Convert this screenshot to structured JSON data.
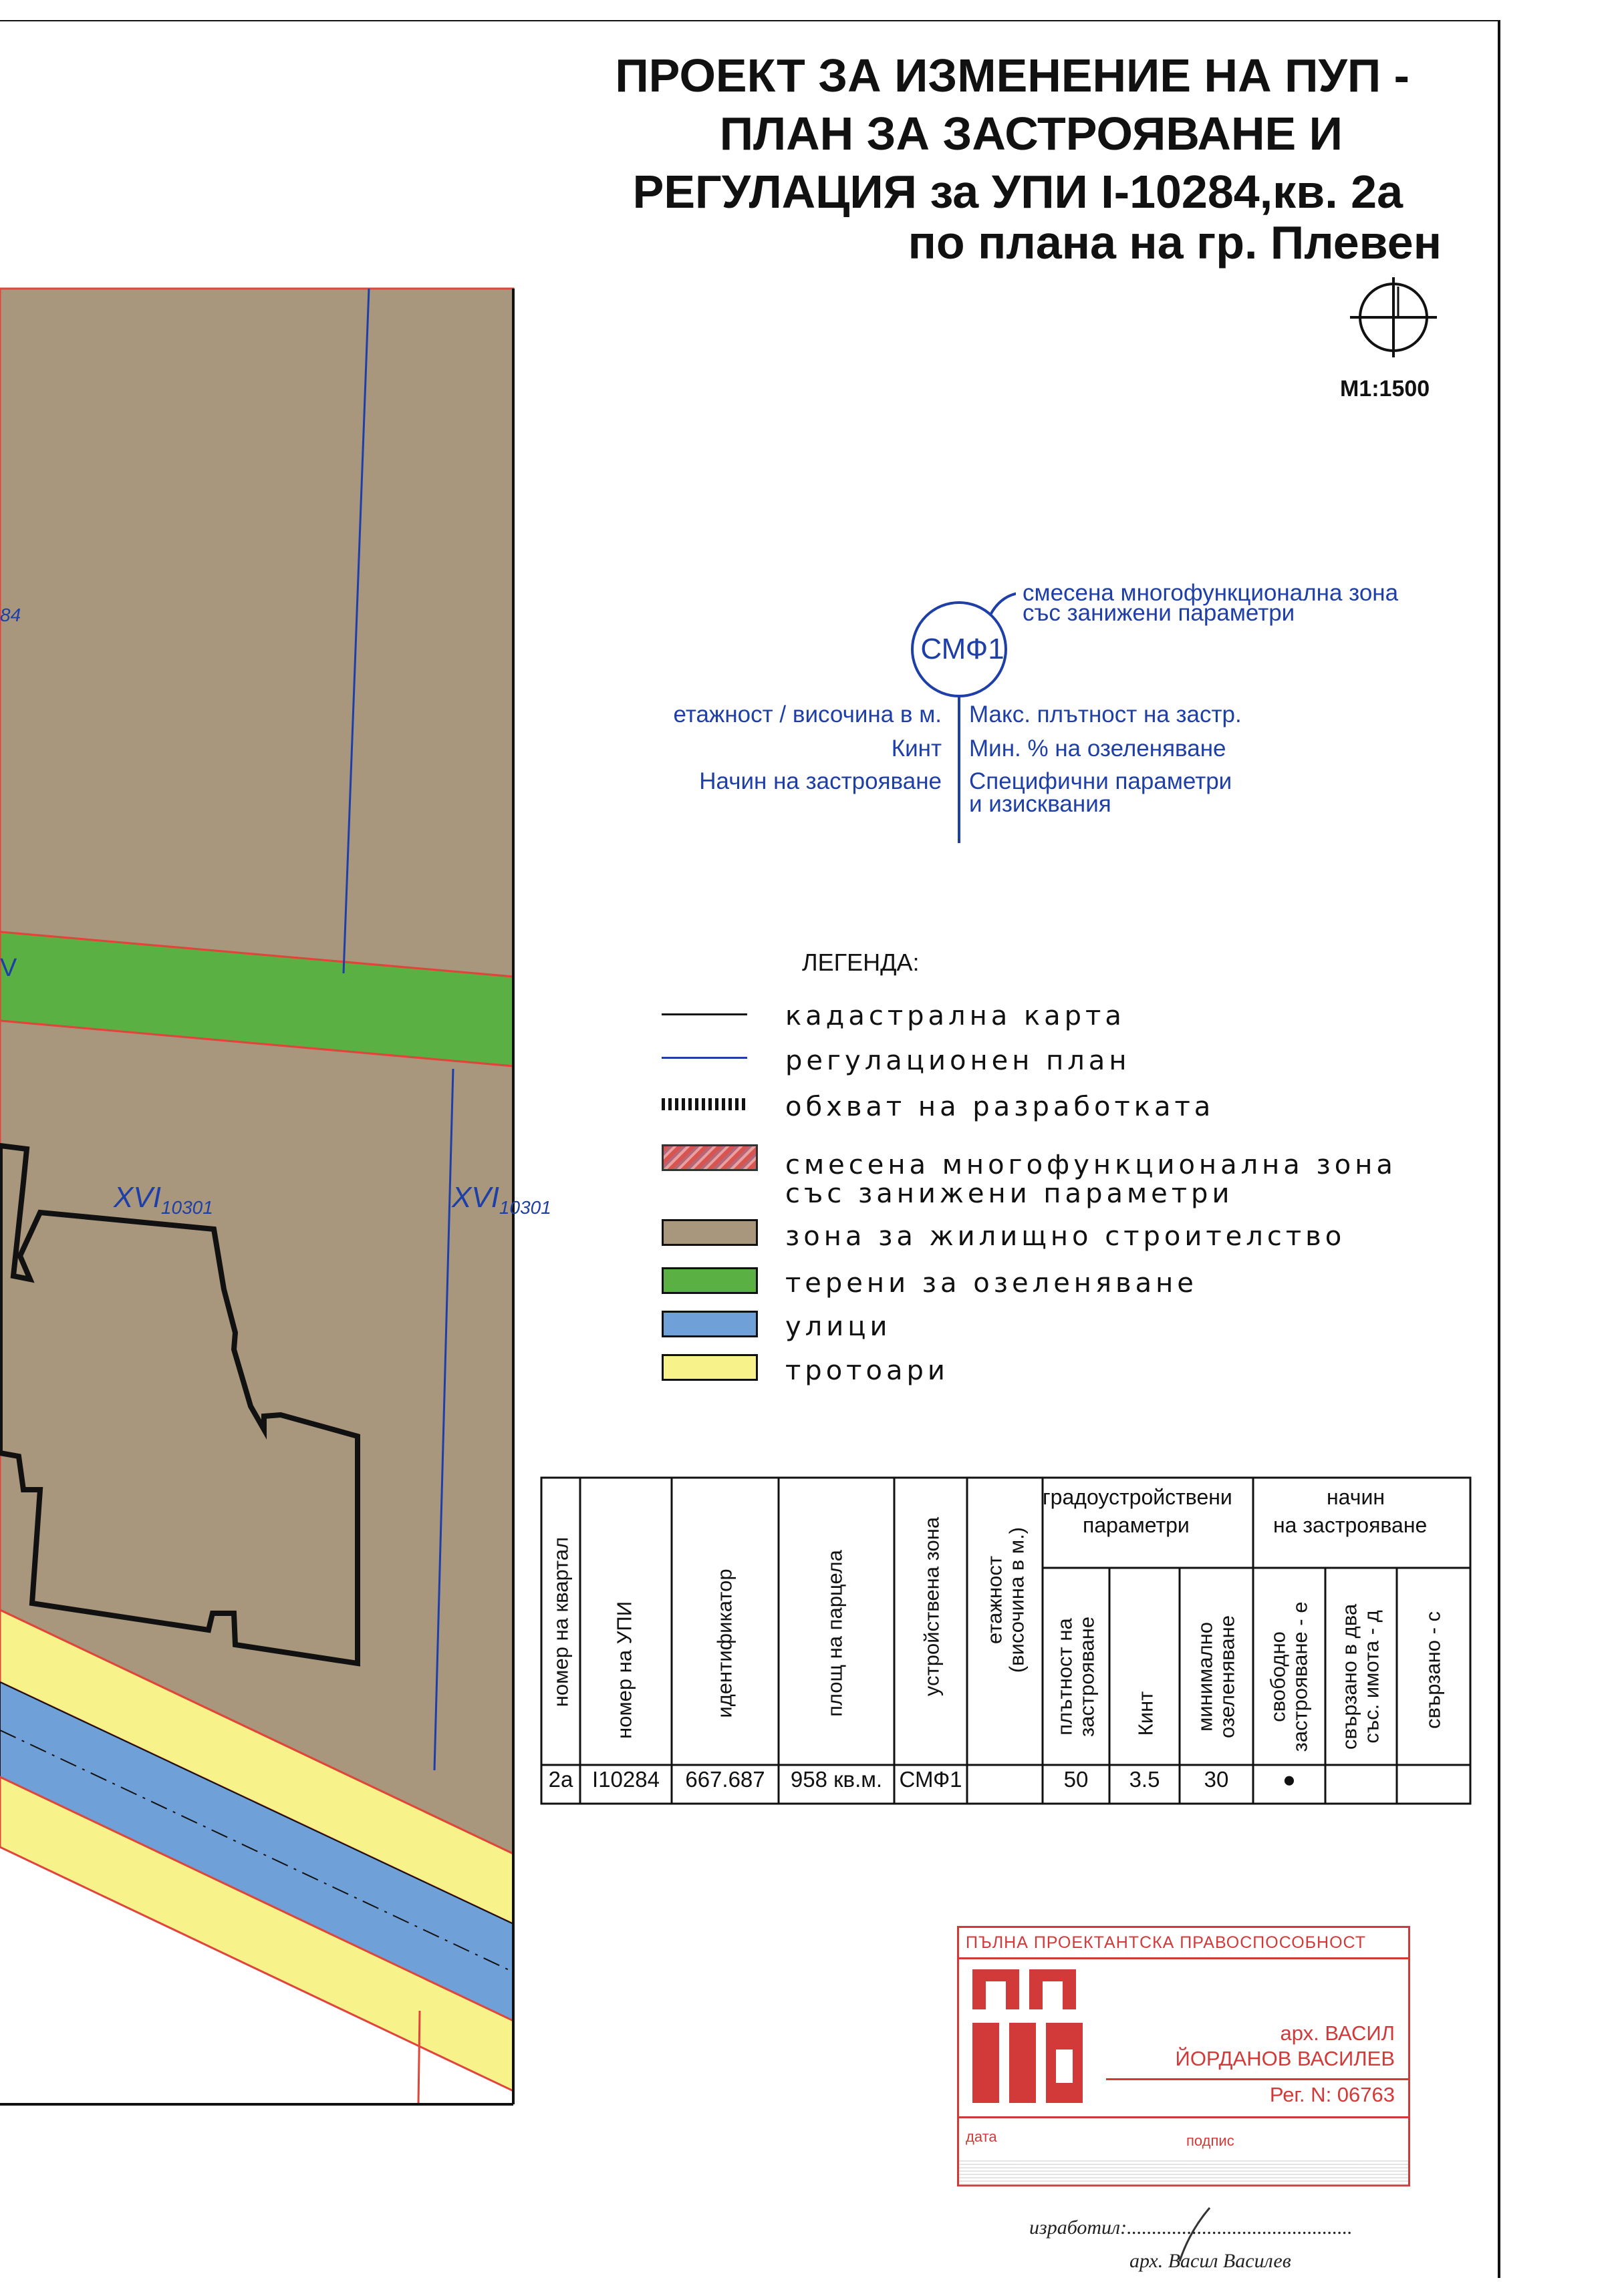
{
  "title": {
    "line1": "ПРОЕКТ ЗА ИЗМЕНЕНИЕ НА ПУП -",
    "line2": "ПЛАН ЗА  ЗАСТРОЯВАНЕ И",
    "line3": "РЕГУЛАЦИЯ за УПИ I-10284,кв. 2а",
    "line4": "по плана на гр. Плевен"
  },
  "scale": "М1:1500",
  "zone_key": {
    "zone_code": "СМФ1",
    "zone_name_line1": "смесена многофункционална зона",
    "zone_name_line2": "със занижени параметри",
    "left_1": "етажност / височина в м.",
    "left_2": "Кинт",
    "left_3": "Начин на застрояване",
    "right_1": "Макс. плътност на застр.",
    "right_2": "Мин. % на озеленяване",
    "right_3a": "Специфични параметри",
    "right_3b": "и изисквания"
  },
  "legend": {
    "title": "ЛЕГЕНДА:",
    "items": [
      {
        "label": "кадастрална карта",
        "symbol": "black-line",
        "color": "#111111"
      },
      {
        "label": "регулационен план",
        "symbol": "blue-line",
        "color": "#1f3fa8"
      },
      {
        "label": "обхват на разработката",
        "symbol": "dashed-boundary",
        "color": "#111111"
      },
      {
        "label": "смесена многофункционална зона",
        "label2": "със занижени параметри",
        "symbol": "hatched-red",
        "color": "#d9534f"
      },
      {
        "label": "зона за жилищно строителство",
        "symbol": "fill",
        "color": "#a8977c"
      },
      {
        "label": "терени за озеленяване",
        "symbol": "fill",
        "color": "#5ab043"
      },
      {
        "label": "улици",
        "symbol": "fill",
        "color": "#6fa0d8"
      },
      {
        "label": "тротоари",
        "symbol": "fill",
        "color": "#f7f38a"
      }
    ]
  },
  "table": {
    "group_headers": {
      "params_line1": "градоустройствени",
      "params_line2": "параметри",
      "method_line1": "начин",
      "method_line2": "на застрояване"
    },
    "col_headers": {
      "kvartal": "номер на квартал",
      "upi": "номер на УПИ",
      "ident": "идентификатор",
      "area": "площ на парцела",
      "zone": "устройствена зона",
      "floors_a": "етажност",
      "floors_b": "(височина в м.)",
      "density_a": "плътност на",
      "density_b": "застрояване",
      "kint": "Кинт",
      "green_a": "минимално",
      "green_b": "озеленяване",
      "free_a": "свободно",
      "free_b": "застрояване - е",
      "twin_a": "свързано в два",
      "twin_b": "със. имота - д",
      "linked": "свързано - с"
    },
    "row": {
      "kvartal": "2а",
      "upi": "I10284",
      "ident": "667.687",
      "area": "958 кв.м.",
      "zone": "СМФ1",
      "floors": "",
      "density": "50",
      "kint": "3.5",
      "green": "30",
      "free_marker": "●",
      "twin": "",
      "linked": ""
    }
  },
  "map_labels": {
    "lot_a": "XVI",
    "lot_a_sub": "10301",
    "lot_b": "XVI",
    "lot_b_sub": "10301",
    "edge_num": "84",
    "edge_v": "V"
  },
  "stamp": {
    "header": "ПЪЛНА ПРОЕКТАНТСКА ПРАВОСПОСОБНОСТ",
    "line1": "арх. ВАСИЛ",
    "line2": "ЙОРДАНОВ ВАСИЛЕВ",
    "reg": "Рег. N: 06763",
    "date_label": "дата",
    "sign_label": "подпис"
  },
  "signature": {
    "made_by": "изработил:",
    "name": "арх. Васил Василев"
  },
  "colors": {
    "residential": "#a8977c",
    "green": "#5ab043",
    "street": "#6fa0d8",
    "sidewalk": "#f7f38a",
    "regulation_line": "#1f3fa8",
    "red_line": "#e0443a",
    "stamp": "#d23a3a"
  }
}
